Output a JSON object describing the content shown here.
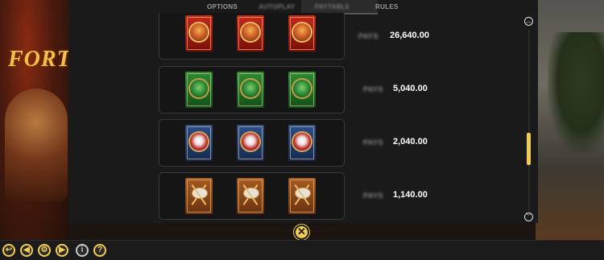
{
  "background": {
    "logo_text": "FORT"
  },
  "tabs": [
    {
      "label": "OPTIONS"
    },
    {
      "label": "AUTOPLAY"
    },
    {
      "label": "PAYTABLE"
    },
    {
      "label": "RULES"
    }
  ],
  "paytable": {
    "rows": [
      {
        "symbol": "red-monkey-king-card",
        "pays_label": "PAYS",
        "value": "26,640.00"
      },
      {
        "symbol": "green-jade-ring-card",
        "pays_label": "PAYS",
        "value": "5,040.00"
      },
      {
        "symbol": "blue-mask-card",
        "pays_label": "PAYS",
        "value": "2,040.00"
      },
      {
        "symbol": "orange-axe-card",
        "pays_label": "PAYS",
        "value": "1,140.00"
      }
    ]
  },
  "scrollbar": {
    "up_icon": "chevron-up-icon",
    "down_icon": "chevron-down-icon",
    "up_glyph": "︿",
    "down_glyph": "﹀"
  },
  "close": {
    "icon": "close-icon",
    "glyph": "✕"
  },
  "controls": [
    {
      "name": "back-icon",
      "glyph": "↩"
    },
    {
      "name": "sound-icon",
      "glyph": "◀"
    },
    {
      "name": "settings-icon",
      "glyph": "⚙"
    },
    {
      "name": "autoplay-icon",
      "glyph": "▶"
    },
    {
      "name": "info-icon",
      "glyph": "i"
    },
    {
      "name": "help-icon",
      "glyph": "?"
    }
  ],
  "colors": {
    "accent": "#f2cc53",
    "panel": "#1a1a1a"
  }
}
